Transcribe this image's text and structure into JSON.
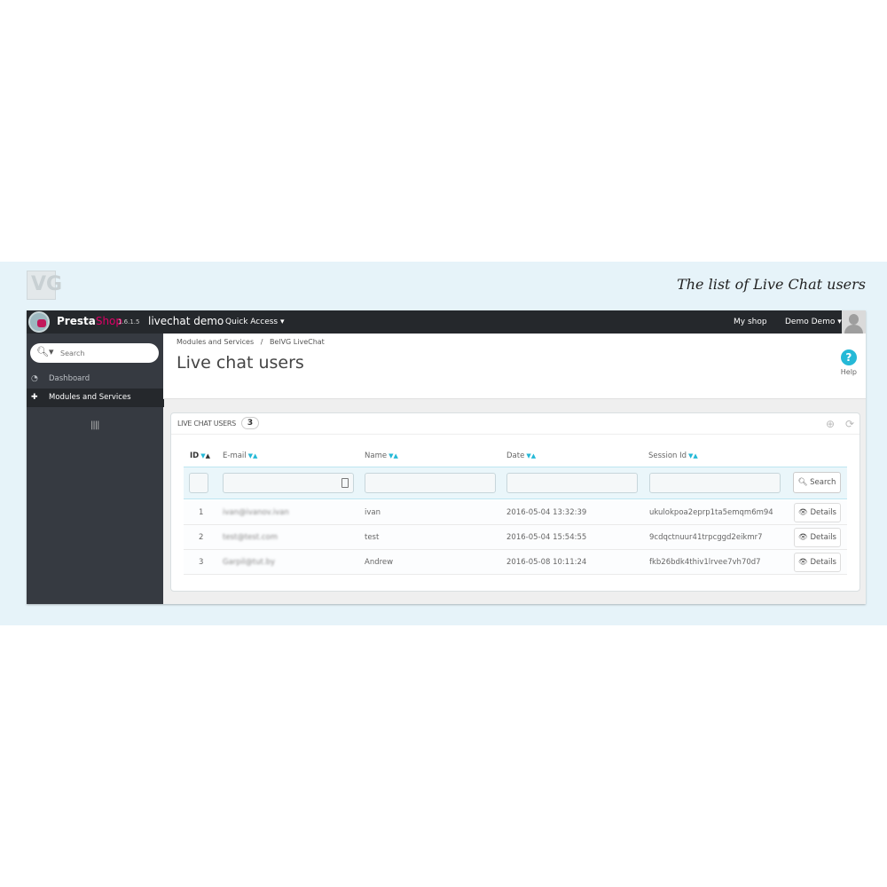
{
  "caption": "The list of Live Chat users",
  "vendor_logo": "VG",
  "topbar": {
    "brand_presta": "Presta",
    "brand_shop": "Shop",
    "version": "1.6.1.5",
    "shop_name": "livechat demo",
    "quick_access": "Quick Access ▾",
    "my_shop": "My shop",
    "user": "Demo Demo ▾"
  },
  "sidebar": {
    "search_placeholder": "Search",
    "items": [
      {
        "label": "Dashboard",
        "icon": "dashboard-icon",
        "active": false
      },
      {
        "label": "Modules and Services",
        "icon": "puzzle-icon",
        "active": true
      }
    ],
    "collapse_glyph": "||||"
  },
  "page": {
    "breadcrumb": [
      "Modules and Services",
      "BelVG LiveChat"
    ],
    "title": "Live chat users",
    "help_label": "Help"
  },
  "panel": {
    "title": "LIVE CHAT USERS",
    "count": "3",
    "columns": [
      "ID",
      "E-mail",
      "Name",
      "Date",
      "Session Id"
    ],
    "search_label": "Search",
    "details_label": "Details",
    "rows": [
      {
        "id": "1",
        "email": "ivan@ivanov.ivan",
        "name": "ivan",
        "date": "2016-05-04 13:32:39",
        "session": "ukulokpoa2eprp1ta5emqm6m94"
      },
      {
        "id": "2",
        "email": "test@test.com",
        "name": "test",
        "date": "2016-05-04 15:54:55",
        "session": "9cdqctnuur41trpcggd2eikmr7"
      },
      {
        "id": "3",
        "email": "Garpil@tut.by",
        "name": "Andrew",
        "date": "2016-05-08 10:11:24",
        "session": "fkb26bdk4thiv1lrvee7vh70d7"
      }
    ]
  },
  "colors": {
    "accent": "#25b9d7",
    "topbar": "#25282c",
    "sidebar": "#363a41",
    "brand_shop": "#df0067",
    "band": "#e6f3f9"
  }
}
